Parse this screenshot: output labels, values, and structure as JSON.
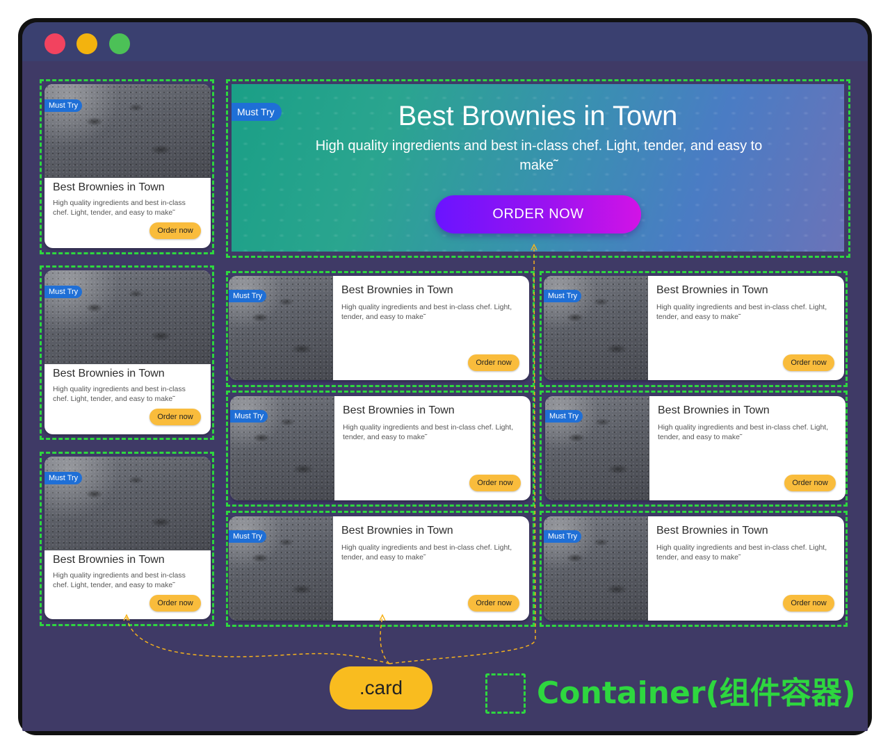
{
  "window": {
    "controls": [
      "close",
      "minimize",
      "maximize"
    ],
    "colors": {
      "close": "#f2435f",
      "minimize": "#f3b30e",
      "maximize": "#4cc157",
      "background": "#3f3a66",
      "container_outline": "#2ed73f"
    }
  },
  "hero": {
    "badge": "Must Try",
    "title": "Best Brownies in Town",
    "subtitle": "High quality ingredients and best in-class chef. Light, tender, and easy to make˜",
    "button": "ORDER NOW"
  },
  "vertical_cards": [
    {
      "badge": "Must Try",
      "title": "Best Brownies in Town",
      "desc": "High quality ingredients and best in-class chef. Light, tender, and easy to make˜",
      "button": "Order now"
    },
    {
      "badge": "Must Try",
      "title": "Best Brownies in Town",
      "desc": "High quality ingredients and best in-class chef. Light, tender, and easy to make˜",
      "button": "Order now"
    },
    {
      "badge": "Must Try",
      "title": "Best Brownies in Town",
      "desc": "High quality ingredients and best in-class chef. Light, tender, and easy to make˜",
      "button": "Order now"
    }
  ],
  "horizontal_cards": [
    {
      "badge": "Must Try",
      "title": "Best Brownies in Town",
      "desc": "High quality ingredients and best in-class chef. Light, tender, and easy to make˜",
      "button": "Order now"
    },
    {
      "badge": "Must Try",
      "title": "Best Brownies in Town",
      "desc": "High quality ingredients and best in-class chef. Light, tender, and easy to make˜",
      "button": "Order now"
    },
    {
      "badge": "Must Try",
      "title": "Best Brownies in Town",
      "desc": "High quality ingredients and best in-class chef. Light, tender, and easy to make˜",
      "button": "Order now"
    },
    {
      "badge": "Must Try",
      "title": "Best Brownies in Town",
      "desc": "High quality ingredients and best in-class chef. Light, tender, and easy to make˜",
      "button": "Order now"
    },
    {
      "badge": "Must Try",
      "title": "Best Brownies in Town",
      "desc": "High quality ingredients and best in-class chef. Light, tender, and easy to make˜",
      "button": "Order now"
    },
    {
      "badge": "Must Try",
      "title": "Best Brownies in Town",
      "desc": "High quality ingredients and best in-class chef. Light, tender, and easy to make˜",
      "button": "Order now"
    }
  ],
  "annotations": {
    "card_label": ".card",
    "container_label": "Container(组件容器)"
  }
}
